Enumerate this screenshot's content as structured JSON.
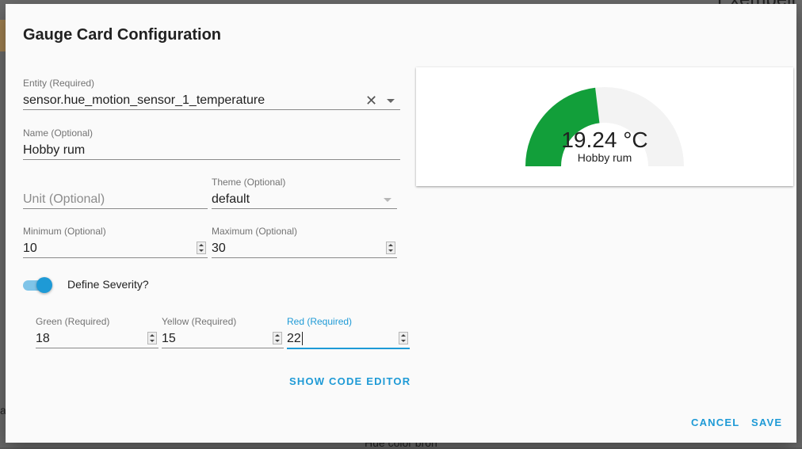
{
  "background": {
    "right_text": "Exempelt",
    "bottom_text": "Hue color bron",
    "left_letter": "a"
  },
  "dialog": {
    "title": "Gauge Card Configuration"
  },
  "form": {
    "entity": {
      "label": "Entity (Required)",
      "value": "sensor.hue_motion_sensor_1_temperature"
    },
    "name": {
      "label": "Name (Optional)",
      "value": "Hobby rum"
    },
    "unit": {
      "placeholder": "Unit (Optional)"
    },
    "theme": {
      "label": "Theme (Optional)",
      "value": "default"
    },
    "minimum": {
      "label": "Minimum (Optional)",
      "value": "10"
    },
    "maximum": {
      "label": "Maximum (Optional)",
      "value": "30"
    },
    "severity_toggle": {
      "label": "Define Severity?",
      "on": true
    },
    "green": {
      "label": "Green (Required)",
      "value": "18"
    },
    "yellow": {
      "label": "Yellow (Required)",
      "value": "15"
    },
    "red": {
      "label": "Red (Required)",
      "value": "22"
    }
  },
  "actions": {
    "show_code_editor": "SHOW CODE EDITOR",
    "cancel": "CANCEL",
    "save": "SAVE"
  },
  "preview": {
    "value_text": "19.24 °C",
    "name": "Hobby rum",
    "gauge_fraction": 0.462,
    "gauge_color": "#129f3a",
    "track_color": "#f3f3f3"
  },
  "colors": {
    "accent": "#1e9ad6"
  }
}
